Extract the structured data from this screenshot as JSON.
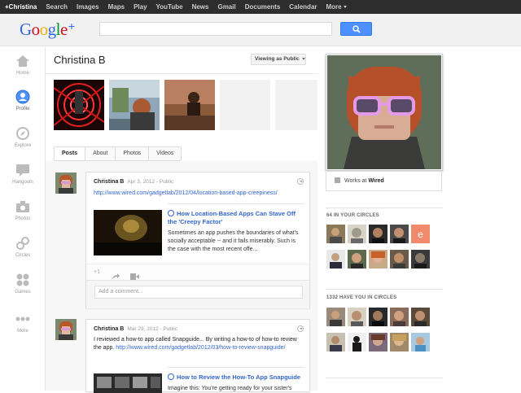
{
  "topbar": {
    "items": [
      "+Christina",
      "Search",
      "Images",
      "Maps",
      "Play",
      "YouTube",
      "News",
      "Gmail",
      "Documents",
      "Calendar",
      "More"
    ]
  },
  "search": {
    "placeholder": ""
  },
  "logo": {
    "text": "Google+",
    "colors": [
      "#3369e8",
      "#d50f25",
      "#eeb211",
      "#3369e8",
      "#009925",
      "#d50f25"
    ]
  },
  "leftnav": {
    "items": [
      {
        "label": "Home",
        "icon": "home-icon"
      },
      {
        "label": "Profile",
        "icon": "profile-icon"
      },
      {
        "label": "Explore",
        "icon": "explore-icon"
      },
      {
        "label": "Hangouts",
        "icon": "hangouts-icon"
      },
      {
        "label": "Photos",
        "icon": "camera-icon"
      },
      {
        "label": "Circles",
        "icon": "circles-icon"
      },
      {
        "label": "Games",
        "icon": "games-icon"
      },
      {
        "label": "More",
        "icon": "more-dots-icon"
      }
    ]
  },
  "profile": {
    "name": "Christina B",
    "viewing_as": "Viewing as Public",
    "works_label": "Works at",
    "works_company": "Wired"
  },
  "tabs": [
    "Posts",
    "About",
    "Photos",
    "Videos"
  ],
  "posts": [
    {
      "author": "Christina B",
      "meta": "Apr 3, 2012  -  Public",
      "link": "http://www.wired.com/gadgetlab/2012/04/location-based-app-creepiness/",
      "attachment_title": "How Location-Based Apps Can Stave Off the 'Creepy Factor'",
      "attachment_desc": "Sometimes an app pushes the boundaries of what's socially acceptable -- and it fails miserably. Such is the case with the most recent offe...",
      "plus_one": "+1",
      "comment_placeholder": "Add a comment..."
    },
    {
      "author": "Christina B",
      "meta": "Mar 29, 2012  -  Public",
      "text": "I reviewed a how-to app called Snapguide... By writing a how-to of how-to review the app.",
      "link": "http://www.wired.com/gadgetlab/2012/03/how-to-review-snapguide/",
      "attachment_title": "How to Review the How-To App Snapguide",
      "attachment_desc": "Imagine this: You're getting ready for your sister's"
    }
  ],
  "circles": {
    "in_your_circles": "64 IN YOUR CIRCLES",
    "have_you": "1332 HAVE YOU IN CIRCLES"
  },
  "colors": {
    "accent": "#4d90fe",
    "link": "#3366cc",
    "topbar": "#2d2d2d"
  }
}
